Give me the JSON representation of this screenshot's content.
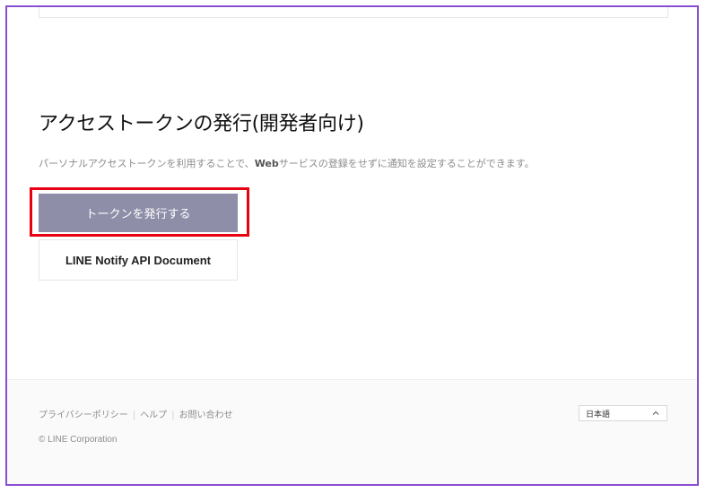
{
  "section": {
    "title": "アクセストークンの発行(開発者向け)",
    "description_before": "パーソナルアクセストークンを利用することで、",
    "description_strong": "Web",
    "description_after": "サービスの登録をせずに通知を設定することができます。"
  },
  "buttons": {
    "issue_token": "トークンを発行する",
    "api_document": "LINE Notify API Document"
  },
  "footer": {
    "links": [
      "プライバシーポリシー",
      "ヘルプ",
      "お問い合わせ"
    ],
    "separator": "|",
    "copyright": "© LINE Corporation",
    "language": "日本語"
  },
  "colors": {
    "frame_border": "#8a4fd0",
    "highlight_border": "#e60012",
    "issue_button_bg": "#8e8ea8"
  },
  "icons": {
    "language_toggle": "chevron-up-icon"
  }
}
